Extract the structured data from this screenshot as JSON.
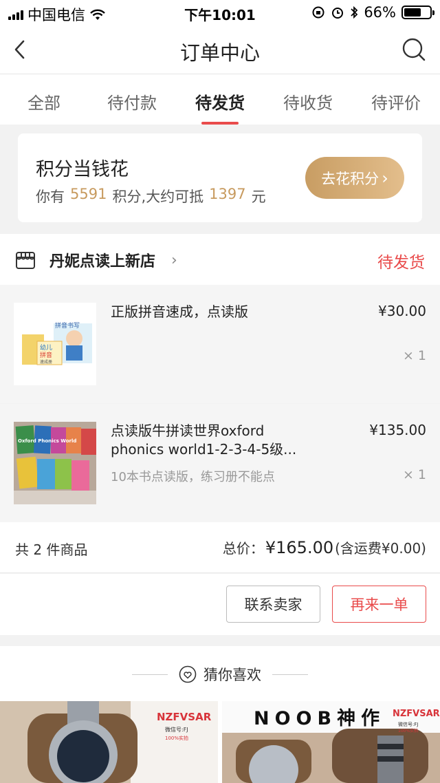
{
  "status_bar": {
    "carrier": "中国电信",
    "time": "下午10:01",
    "battery": "66%",
    "battery_level": 0.66
  },
  "nav": {
    "title": "订单中心"
  },
  "tabs": [
    {
      "label": "全部"
    },
    {
      "label": "待付款"
    },
    {
      "label": "待发货",
      "active": true
    },
    {
      "label": "待收货"
    },
    {
      "label": "待评价"
    }
  ],
  "points_card": {
    "title": "积分当钱花",
    "prefix": "你有",
    "points": "5591",
    "middle": "积分,大约可抵",
    "amount": "1397",
    "suffix": "元",
    "button_label": "去花积分",
    "button_arrow": "›"
  },
  "order": {
    "shop_name": "丹妮点读上新店",
    "shop_chevron": "›",
    "status": "待发货",
    "items": [
      {
        "name": "正版拼音速成，点读版",
        "spec": "",
        "price": "¥30.00",
        "qty": "× 1",
        "thumb_text": [
          "拼音书写",
          "幼儿",
          "拼音",
          "速成册"
        ]
      },
      {
        "name": "点读版牛拼读世界oxford phonics world1-2-3-4-5级...",
        "spec": "10本书点读版，练习册不能点",
        "price": "¥135.00",
        "qty": "× 1",
        "thumb_text": [
          "Oxford Phonics World"
        ]
      }
    ],
    "count_text": "共 2 件商品",
    "total_label": "总价：",
    "total_amount": "¥165.00",
    "shipping_note": "(含运费¥0.00)",
    "contact_button": "联系卖家",
    "reorder_button": "再来一单"
  },
  "recommend": {
    "title": "猜你喜欢",
    "products": [
      {
        "watermark": "NZFVSAR",
        "note": "微信号:FJ",
        "note2": "100%实拍"
      },
      {
        "watermark": "NOOB神作",
        "brand": "NZFVSAR",
        "note": "微信号:FJ",
        "note2": "100%实拍"
      }
    ]
  },
  "colors": {
    "accent": "#e94b4b",
    "gold": "#c79a5e"
  }
}
